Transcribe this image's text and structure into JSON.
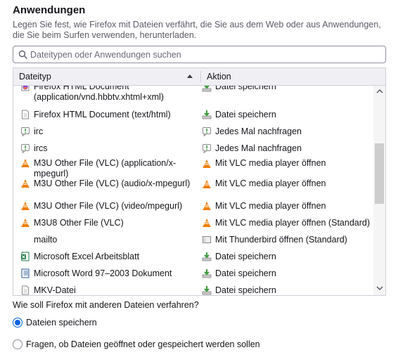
{
  "section": {
    "title": "Anwendungen",
    "description": "Legen Sie fest, wie Firefox mit Dateien verfährt, die Sie aus dem Web oder aus Anwendungen, die Sie beim Surfen verwenden, herunterladen."
  },
  "search": {
    "placeholder": "Dateitypen oder Anwendungen suchen",
    "value": "",
    "icon": "search-icon"
  },
  "table": {
    "columns": {
      "type": "Dateityp",
      "action": "Aktion"
    },
    "sort": "ascending",
    "rows": [
      {
        "type": "Firefox HTML Document (application/vnd.hbbtv.xhtml+xml)",
        "type_icon": "firefox-document-icon",
        "action": "Datei speichern",
        "action_icon": "download-icon"
      },
      {
        "type": "Firefox HTML Document (text/html)",
        "type_icon": "document-icon",
        "action": "Datei speichern",
        "action_icon": "download-icon"
      },
      {
        "type": "irc",
        "type_icon": "ask-icon",
        "action": "Jedes Mal nachfragen",
        "action_icon": "ask-icon"
      },
      {
        "type": "ircs",
        "type_icon": "ask-icon",
        "action": "Jedes Mal nachfragen",
        "action_icon": "ask-icon"
      },
      {
        "type": "M3U Other File (VLC) (application/x-mpegurl)",
        "type_icon": "vlc-icon",
        "action": "Mit VLC media player öffnen",
        "action_icon": "vlc-icon"
      },
      {
        "type": "M3U Other File (VLC) (audio/x-mpegurl)",
        "type_icon": "vlc-icon",
        "action": "Mit VLC media player öffnen",
        "action_icon": "vlc-icon"
      },
      {
        "type": "M3U Other File (VLC) (video/mpegurl)",
        "type_icon": "vlc-icon",
        "action": "Mit VLC media player öffnen",
        "action_icon": "vlc-icon"
      },
      {
        "type": "M3U8 Other File (VLC)",
        "type_icon": "vlc-icon",
        "action": "Mit VLC media player öffnen (Standard)",
        "action_icon": "vlc-icon"
      },
      {
        "type": "mailto",
        "type_icon": "",
        "action": "Mit Thunderbird öffnen (Standard)",
        "action_icon": "thunderbird-icon"
      },
      {
        "type": "Microsoft Excel Arbeitsblatt",
        "type_icon": "excel-icon",
        "action": "Datei speichern",
        "action_icon": "download-icon"
      },
      {
        "type": "Microsoft Word 97–2003 Dokument",
        "type_icon": "word-icon",
        "action": "Datei speichern",
        "action_icon": "download-icon"
      },
      {
        "type": "MKV-Datei",
        "type_icon": "document-icon",
        "action": "Datei speichern",
        "action_icon": "download-icon"
      }
    ]
  },
  "other_files": {
    "question": "Wie soll Firefox mit anderen Dateien verfahren?",
    "options": [
      {
        "label": "Dateien speichern",
        "checked": true
      },
      {
        "label": "Fragen, ob Dateien geöffnet oder gespeichert werden sollen",
        "checked": false
      }
    ]
  },
  "colors": {
    "accent": "#0060df",
    "vlc_orange": "#f07d00",
    "download_green": "#3c9a3c",
    "excel_green": "#1f7a45",
    "word_blue": "#2b5797"
  }
}
